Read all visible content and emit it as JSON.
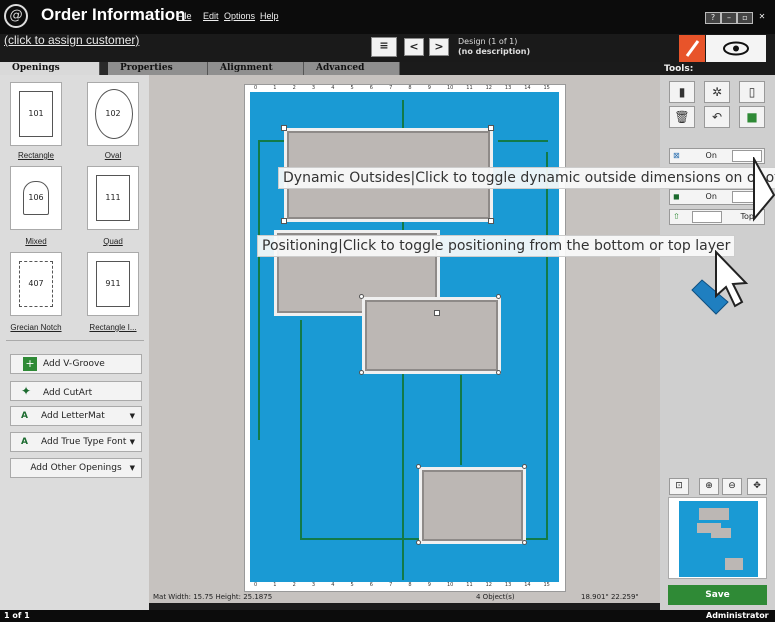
{
  "app": {
    "title": "Order Information",
    "logo": "@"
  },
  "menu": [
    "File",
    "Edit",
    "Options",
    "Help"
  ],
  "window_buttons": [
    "?",
    "–",
    "▫",
    "✕"
  ],
  "customer_link": "(click to assign customer)",
  "design": {
    "line1": "Design  (1 of 1)",
    "line2": "(no description)"
  },
  "tabs": [
    "Openings",
    "Properties",
    "Alignment",
    "Advanced"
  ],
  "tools_label": "Tools:",
  "openings": [
    {
      "code": "101",
      "label": "Rectangle"
    },
    {
      "code": "102",
      "label": "Oval"
    },
    {
      "code": "106",
      "label": "Mixed"
    },
    {
      "code": "111",
      "label": "Quad"
    },
    {
      "code": "407",
      "label": "Grecian Notch"
    },
    {
      "code": "911",
      "label": "Rectangle I..."
    }
  ],
  "add_buttons": [
    "Add V-Groove",
    "Add CutArt",
    "Add LetterMat",
    "Add True Type Font",
    "Add Other Openings"
  ],
  "toggles": {
    "dynamic": "On",
    "mid": "On",
    "position": "Top"
  },
  "tooltips": {
    "dynamic": "Dynamic Outsides|Click to toggle dynamic outside dimensions on or off",
    "positioning": "Positioning|Click to toggle positioning from the bottom or top layer"
  },
  "status": {
    "mat": "Mat Width: 15.75  Height: 25.1875",
    "objects": "4 Object(s)",
    "coords": "18.901\"  22.259\""
  },
  "save_label": "Save",
  "footer": {
    "pages": "1 of 1",
    "user": "Administrator"
  },
  "ruler_top": [
    "0",
    "1",
    "2",
    "3",
    "4",
    "5",
    "6",
    "7",
    "8",
    "9",
    "10",
    "11",
    "12",
    "13",
    "14",
    "15"
  ],
  "colors": {
    "mat_blue": "#1a9ad4",
    "save_green": "#2f8a36",
    "pen_orange": "#e8542a"
  }
}
